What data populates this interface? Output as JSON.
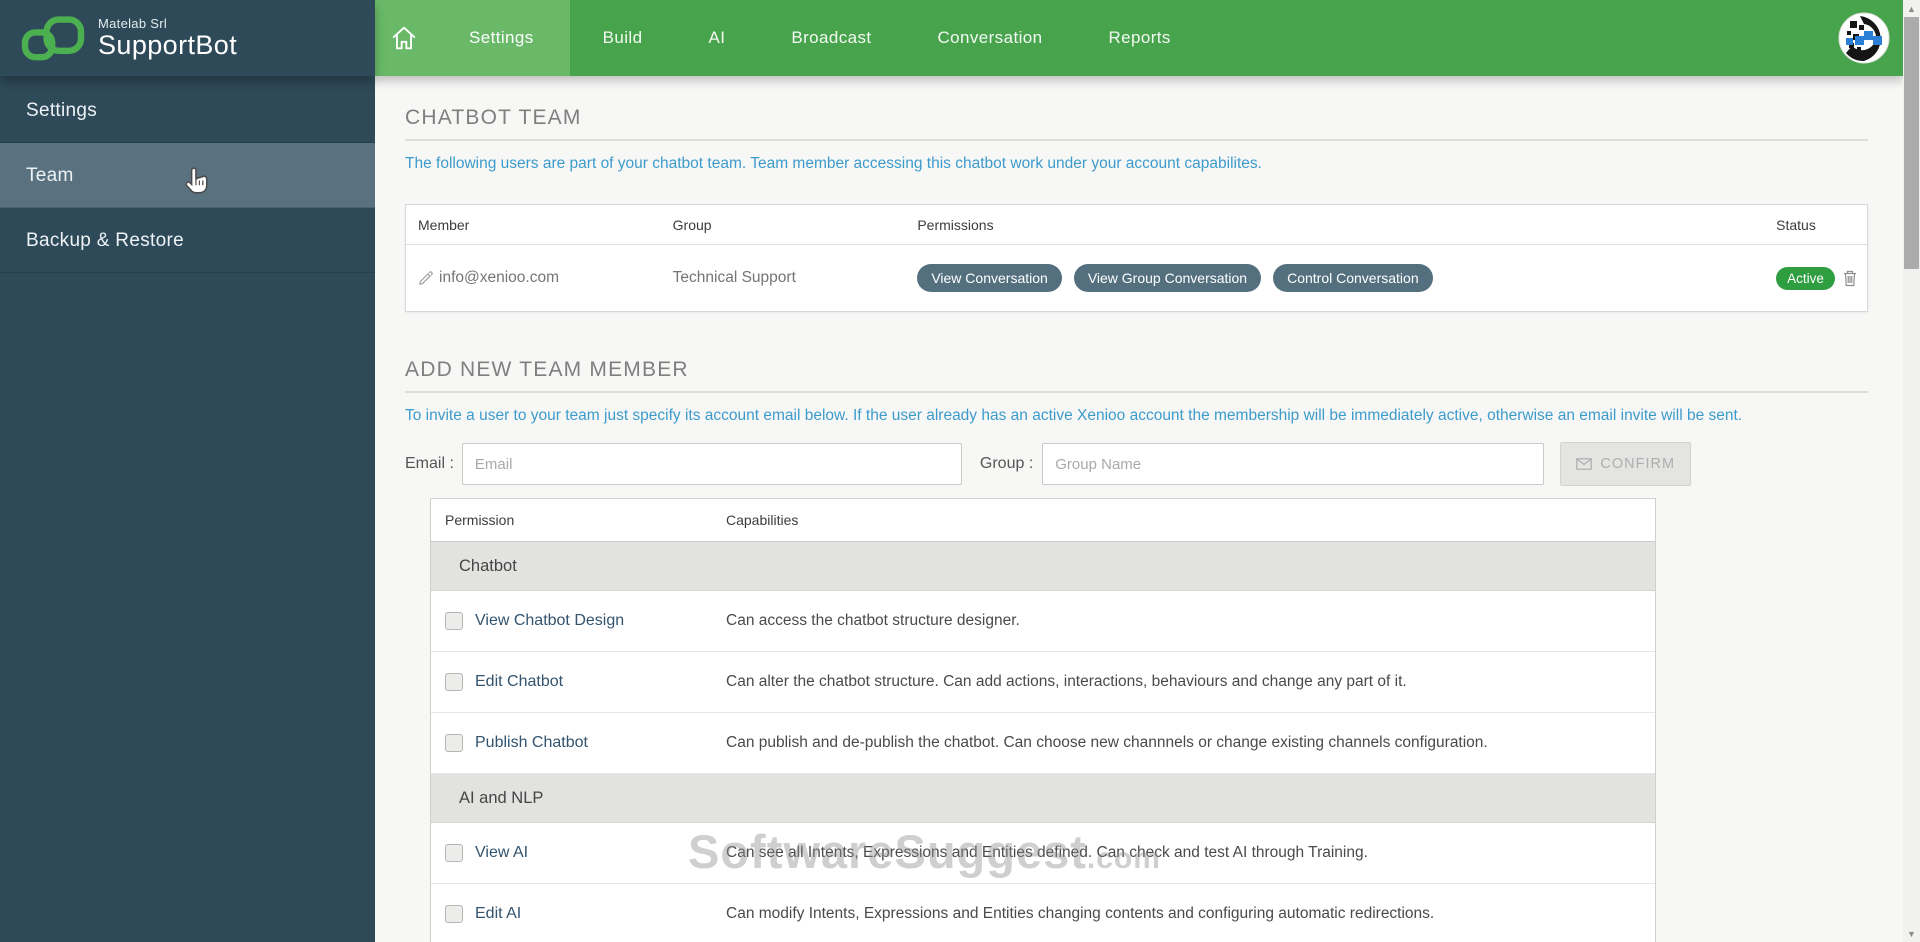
{
  "sidebar": {
    "company": "Matelab Srl",
    "app_name": "SupportBot",
    "items": [
      {
        "label": "Settings",
        "active": false
      },
      {
        "label": "Team",
        "active": true
      },
      {
        "label": "Backup & Restore",
        "active": false
      }
    ]
  },
  "topnav": {
    "items": [
      {
        "label": "Settings",
        "active": true
      },
      {
        "label": "Build",
        "active": false
      },
      {
        "label": "AI",
        "active": false
      },
      {
        "label": "Broadcast",
        "active": false
      },
      {
        "label": "Conversation",
        "active": false
      },
      {
        "label": "Reports",
        "active": false
      }
    ]
  },
  "chatbot_team": {
    "title": "CHATBOT TEAM",
    "description": "The following users are part of your chatbot team. Team member accessing this chatbot work under your account capabilites.",
    "table": {
      "headers": [
        "Member",
        "Group",
        "Permissions",
        "Status"
      ],
      "row": {
        "member": "info@xenioo.com",
        "group": "Technical Support",
        "permissions": [
          "View Conversation",
          "View Group Conversation",
          "Control Conversation"
        ],
        "status": "Active"
      }
    }
  },
  "add_member": {
    "title": "ADD NEW TEAM MEMBER",
    "description": "To invite a user to your team just specify its account email below. If the user already has an active Xenioo account the membership will be immediately active, otherwise an email invite will be sent.",
    "email_label": "Email :",
    "email_placeholder": "Email",
    "email_value": "",
    "group_label": "Group :",
    "group_placeholder": "Group Name",
    "group_value": "",
    "confirm_label": "CONFIRM"
  },
  "permissions_table": {
    "headers": [
      "Permission",
      "Capabilities"
    ],
    "sections": [
      {
        "title": "Chatbot",
        "rows": [
          {
            "label": "View Chatbot Design",
            "checked": false,
            "capability": "Can access the chatbot structure designer."
          },
          {
            "label": "Edit Chatbot",
            "checked": false,
            "capability": "Can alter the chatbot structure. Can add actions, interactions, behaviours and change any part of it."
          },
          {
            "label": "Publish Chatbot",
            "checked": false,
            "capability": "Can publish and de-publish the chatbot. Can choose new channnels or change existing channels configuration."
          }
        ]
      },
      {
        "title": "AI and NLP",
        "rows": [
          {
            "label": "View AI",
            "checked": false,
            "capability": "Can see all Intents, Expressions and Entities defined. Can check and test AI through Training."
          },
          {
            "label": "Edit AI",
            "checked": false,
            "capability": "Can modify Intents, Expressions and Entities changing contents and configuring automatic redirections."
          }
        ]
      }
    ]
  },
  "watermark": {
    "main": "SoftwareSuggest",
    "suffix": ".com"
  },
  "colors": {
    "nav_green": "#48a44c",
    "nav_green_active": "#69b969",
    "sidebar_bg": "#2e4a59",
    "sidebar_active": "#5a7280",
    "link_blue": "#3d9bcb",
    "badge_slate": "#54707f",
    "status_green": "#2f9e41",
    "logo_green": "#4caf50"
  }
}
